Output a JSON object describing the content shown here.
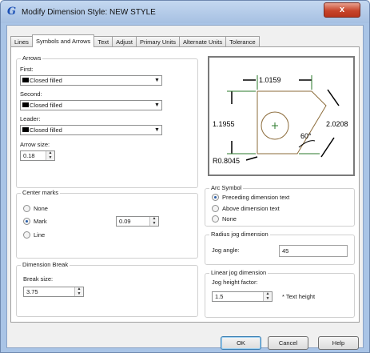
{
  "window": {
    "title": "Modify Dimension Style: NEW STYLE",
    "close_glyph": "x"
  },
  "tabs": [
    {
      "label": "Lines"
    },
    {
      "label": "Symbols and Arrows"
    },
    {
      "label": "Text"
    },
    {
      "label": "Adjust"
    },
    {
      "label": "Primary Units"
    },
    {
      "label": "Alternate Units"
    },
    {
      "label": "Tolerance"
    }
  ],
  "arrows": {
    "title": "Arrows",
    "first_label": "First:",
    "first_value": "Closed filled",
    "second_label": "Second:",
    "second_value": "Closed filled",
    "leader_label": "Leader:",
    "leader_value": "Closed filled",
    "size_label": "Arrow size:",
    "size_value": "0.18"
  },
  "center_marks": {
    "title": "Center marks",
    "options": [
      "None",
      "Mark",
      "Line"
    ],
    "selected": "Mark",
    "value": "0.09"
  },
  "dimension_break": {
    "title": "Dimension Break",
    "size_label": "Break size:",
    "size_value": "3.75"
  },
  "arc_symbol": {
    "title": "Arc Symbol",
    "options": [
      "Preceding dimension text",
      "Above dimension text",
      "None"
    ],
    "selected": "Preceding dimension text"
  },
  "radius_jog": {
    "title": "Radius jog dimension",
    "angle_label": "Jog angle:",
    "angle_value": "45"
  },
  "linear_jog": {
    "title": "Linear jog dimension",
    "height_label": "Jog height factor:",
    "height_value": "1.5",
    "suffix": "* Text height"
  },
  "preview": {
    "dim_top": "1.0159",
    "dim_left": "1.1955",
    "dim_right": "2.0208",
    "angle": "60°",
    "radius": "R0.8045"
  },
  "buttons": {
    "ok": "OK",
    "cancel": "Cancel",
    "help": "Help"
  },
  "colors": {
    "arrow_swatch": "#000000",
    "dim_line": "#2a7a2a",
    "shape": "#8b6b3a",
    "title_icon": "#1a4fb5"
  },
  "icons": {
    "app": "autocad-g-icon",
    "close": "close-icon",
    "dropdown": "chevron-down-icon"
  }
}
